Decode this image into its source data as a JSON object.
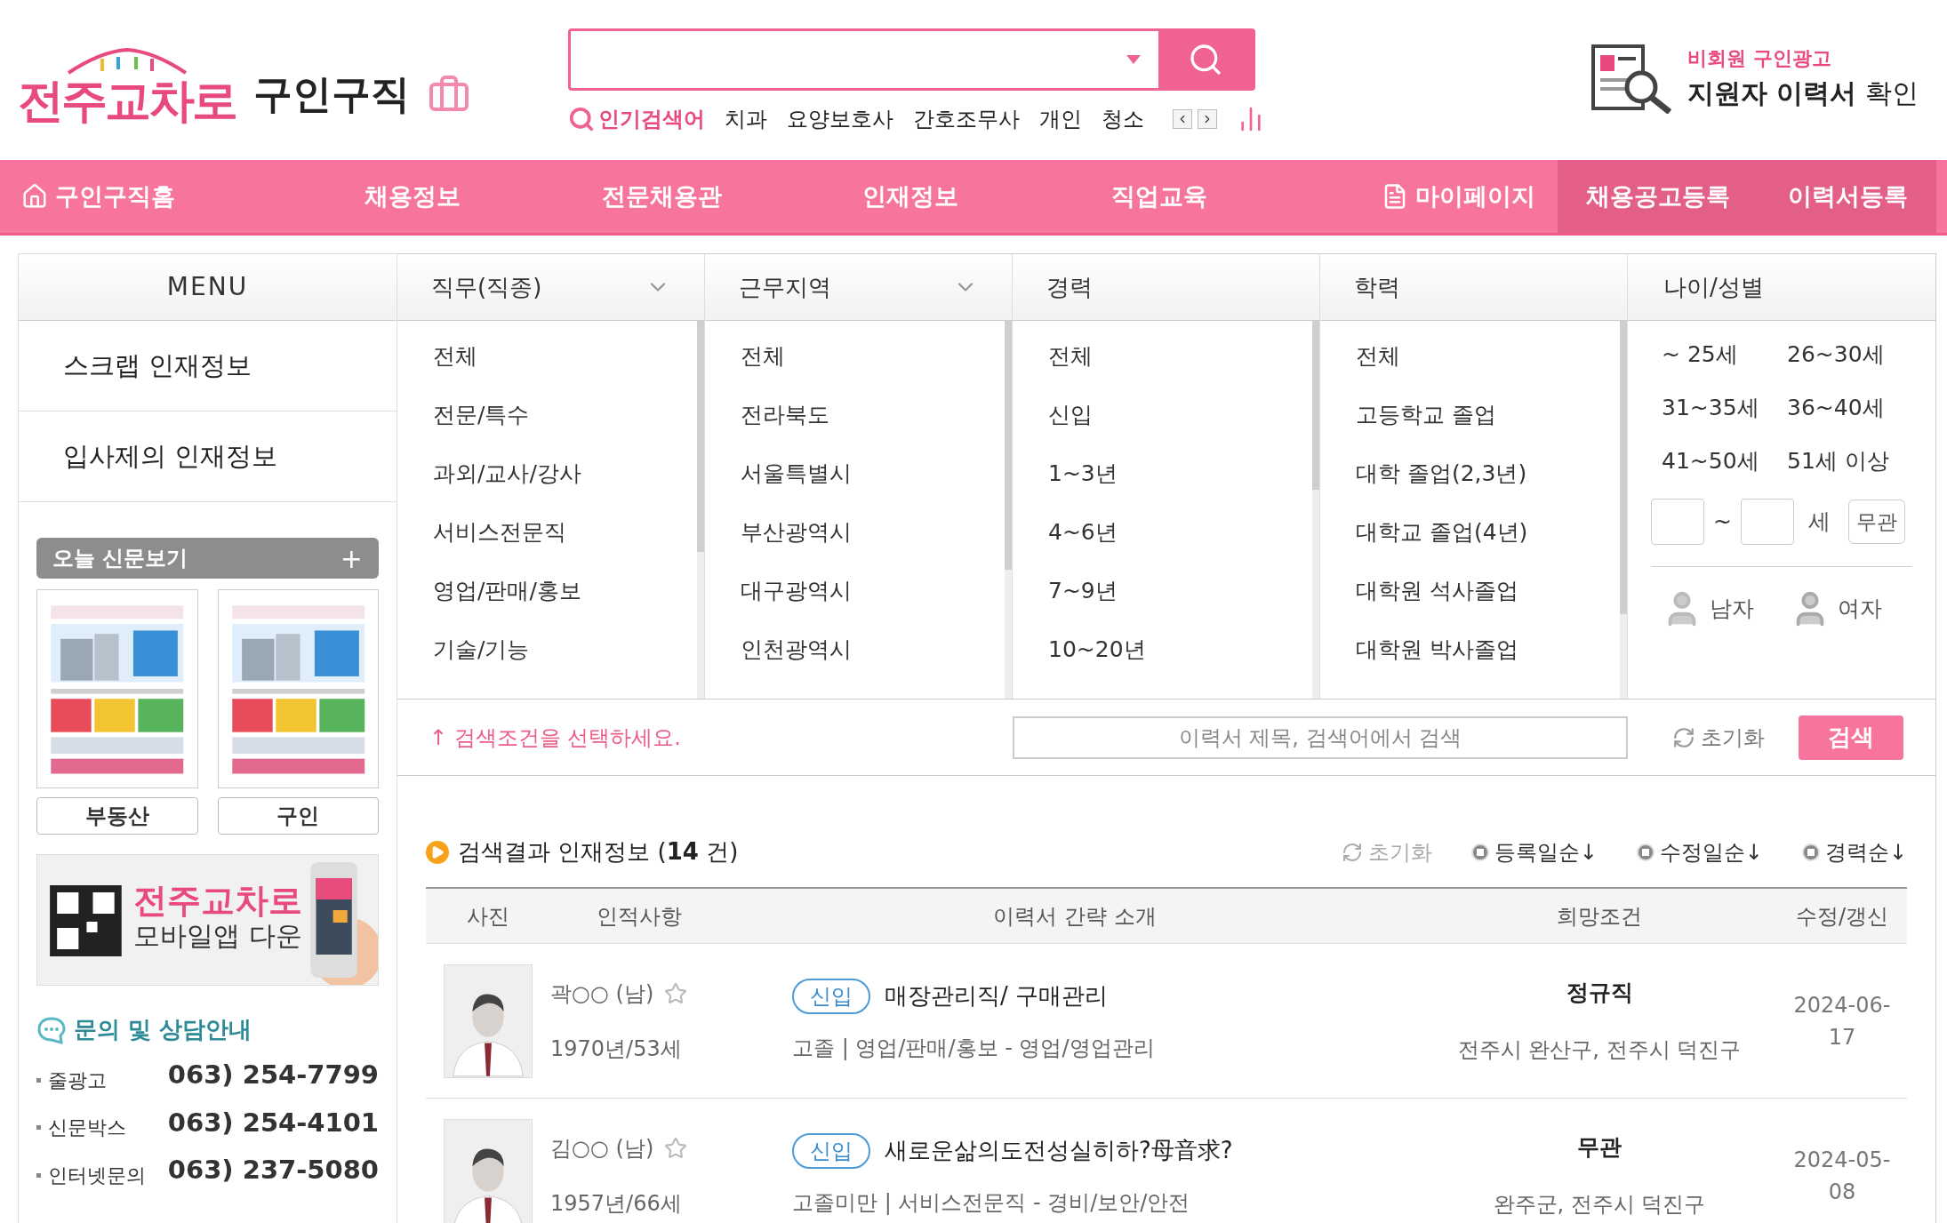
{
  "header": {
    "logo": "전주교차로",
    "section": "구인구직",
    "popular": {
      "label": "인기검색어",
      "terms": [
        "치과",
        "요양보호사",
        "간호조무사",
        "개인",
        "청소"
      ]
    },
    "promo": {
      "line1": "비회원 구인광고",
      "line2": "**지원자 이력서** 확인"
    }
  },
  "nav": {
    "items": [
      {
        "label": "구인구직홈",
        "kind": "home"
      },
      {
        "label": "채용정보",
        "kind": "plain"
      },
      {
        "label": "전문채용관",
        "kind": "plain"
      },
      {
        "label": "인재정보",
        "kind": "plain"
      },
      {
        "label": "직업교육",
        "kind": "plain"
      },
      {
        "label": "마이페이지",
        "kind": "page"
      }
    ],
    "actions": [
      "채용공고등록",
      "이력서등록"
    ]
  },
  "sidebar": {
    "menu_title": "MENU",
    "items": [
      "스크랩 인재정보",
      "입사제의 인재정보"
    ],
    "newspaper": {
      "title": "오늘 신문보기",
      "more": "+",
      "papers": [
        {
          "label": "부동산"
        },
        {
          "label": "구인"
        }
      ]
    },
    "app_banner": {
      "brand": "전주교차로",
      "text": "모바일앱 다운"
    },
    "contact": {
      "title": "문의 및 상담안내",
      "rows": [
        {
          "label": "줄광고",
          "phone": "063) 254-7799"
        },
        {
          "label": "신문박스",
          "phone": "063) 254-4101"
        },
        {
          "label": "인터넷문의",
          "phone": "063) 237-5080"
        }
      ]
    }
  },
  "filters": {
    "columns": [
      {
        "title": "직무(직종)",
        "dropdown": true,
        "options": [
          "전체",
          "전문/특수",
          "과외/교사/강사",
          "서비스전문직",
          "영업/판매/홍보",
          "기술/기능"
        ]
      },
      {
        "title": "근무지역",
        "dropdown": true,
        "options": [
          "전체",
          "전라북도",
          "서울특별시",
          "부산광역시",
          "대구광역시",
          "인천광역시"
        ]
      },
      {
        "title": "경력",
        "dropdown": false,
        "options": [
          "전체",
          "신입",
          "1~3년",
          "4~6년",
          "7~9년",
          "10~20년"
        ]
      },
      {
        "title": "학력",
        "dropdown": false,
        "options": [
          "전체",
          "고등학교 졸업",
          "대학 졸업(2,3년)",
          "대학교 졸업(4년)",
          "대학원 석사졸업",
          "대학원 박사졸업"
        ]
      }
    ],
    "age": {
      "title": "나이/성별",
      "options": [
        "~ 25세",
        "26~30세",
        "31~35세",
        "36~40세",
        "41~50세",
        "51세 이상"
      ],
      "tilde": "~",
      "unit": "세",
      "any": "무관",
      "genders": [
        {
          "label": "남자",
          "kind": "male"
        },
        {
          "label": "여자",
          "kind": "female"
        }
      ]
    },
    "hint": "↑ 검색조건을 선택하세요.",
    "search_placeholder": "이력서 제목, 검색어에서 검색",
    "reset": "초기화",
    "search_button": "검색"
  },
  "results": {
    "title": "검색결과 인재정보 (**14** 건)",
    "reset": "초기화",
    "sorts": [
      "등록일순↓",
      "수정일순↓",
      "경력순↓"
    ],
    "columns": [
      "사진",
      "인적사항",
      "이력서 간략 소개",
      "희망조건",
      "수정/갱신"
    ],
    "rows": [
      {
        "name": "곽○○ (남)",
        "starred": false,
        "birth": "1970년/53세",
        "badge": "신입",
        "title": "매장관리직/ 구매관리",
        "detail": "고졸 | 영업/판매/홍보 - 영업/영업관리",
        "condition": "정규직",
        "location": "전주시 완산구, 전주시 덕진구",
        "date": "2024-06-17"
      },
      {
        "name": "김○○ (남)",
        "starred": false,
        "birth": "1957년/66세",
        "badge": "신입",
        "title": "새로운삶의도전성실히하?母音求?",
        "detail": "고졸미만 | 서비스전문직 - 경비/보안/안전",
        "condition": "무관",
        "location": "완주군, 전주시 덕진구",
        "date": "2024-05-08"
      }
    ]
  }
}
